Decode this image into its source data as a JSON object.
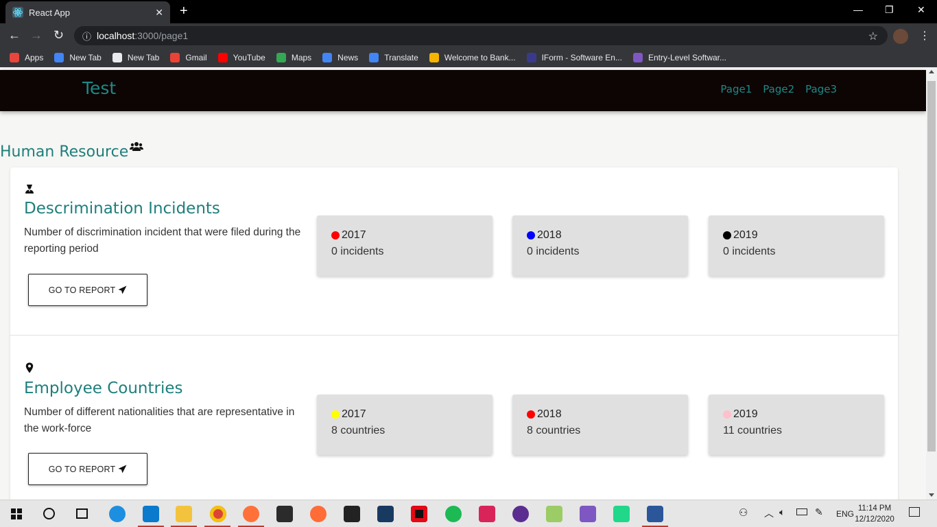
{
  "browser": {
    "tab_title": "React App",
    "url_host": "localhost",
    "url_path": ":3000/page1",
    "bookmarks": [
      {
        "label": "Apps",
        "icon": "apps-grid-icon",
        "color": "#e8453c"
      },
      {
        "label": "New Tab",
        "icon": "google-icon",
        "color": "#4285f4"
      },
      {
        "label": "New Tab",
        "icon": "globe-icon",
        "color": "#e8eaed"
      },
      {
        "label": "Gmail",
        "icon": "gmail-icon",
        "color": "#ea4335"
      },
      {
        "label": "YouTube",
        "icon": "youtube-icon",
        "color": "#ff0000"
      },
      {
        "label": "Maps",
        "icon": "maps-icon",
        "color": "#34a853"
      },
      {
        "label": "News",
        "icon": "news-icon",
        "color": "#4285f4"
      },
      {
        "label": "Translate",
        "icon": "translate-icon",
        "color": "#4285f4"
      },
      {
        "label": "Welcome to Bank...",
        "icon": "bank-icon",
        "color": "#f4b400"
      },
      {
        "label": "IForm - Software En...",
        "icon": "iform-icon",
        "color": "#3a3a8c"
      },
      {
        "label": "Entry-Level Softwar...",
        "icon": "list-icon",
        "color": "#7e57c2"
      }
    ]
  },
  "app": {
    "brand": "Test",
    "nav": [
      "Page1",
      "Page2",
      "Page3"
    ],
    "accent": "#1d8a86",
    "section_title": "Human Resource"
  },
  "metrics": [
    {
      "title": "Descrimination Incidents",
      "icon": "user-secret-icon",
      "description": "Number of discrimination incident that were filed during the reporting period",
      "button": "GO TO REPORT",
      "stats": [
        {
          "year": "2017",
          "value": "0 incidents",
          "color": "#ff0000"
        },
        {
          "year": "2018",
          "value": "0 incidents",
          "color": "#0000ff"
        },
        {
          "year": "2019",
          "value": "0 incidents",
          "color": "#000000"
        }
      ]
    },
    {
      "title": "Employee Countries",
      "icon": "map-marker-icon",
      "description": "Number of different nationalities that are representative in the work-force",
      "button": "GO TO REPORT",
      "stats": [
        {
          "year": "2017",
          "value": "8 countries",
          "color": "#ffff00"
        },
        {
          "year": "2018",
          "value": "8 countries",
          "color": "#ff0000"
        },
        {
          "year": "2019",
          "value": "11 countries",
          "color": "#ffc0cb"
        }
      ]
    }
  ],
  "taskbar": {
    "language": "ENG",
    "time": "11:14 PM",
    "date": "12/12/2020"
  }
}
